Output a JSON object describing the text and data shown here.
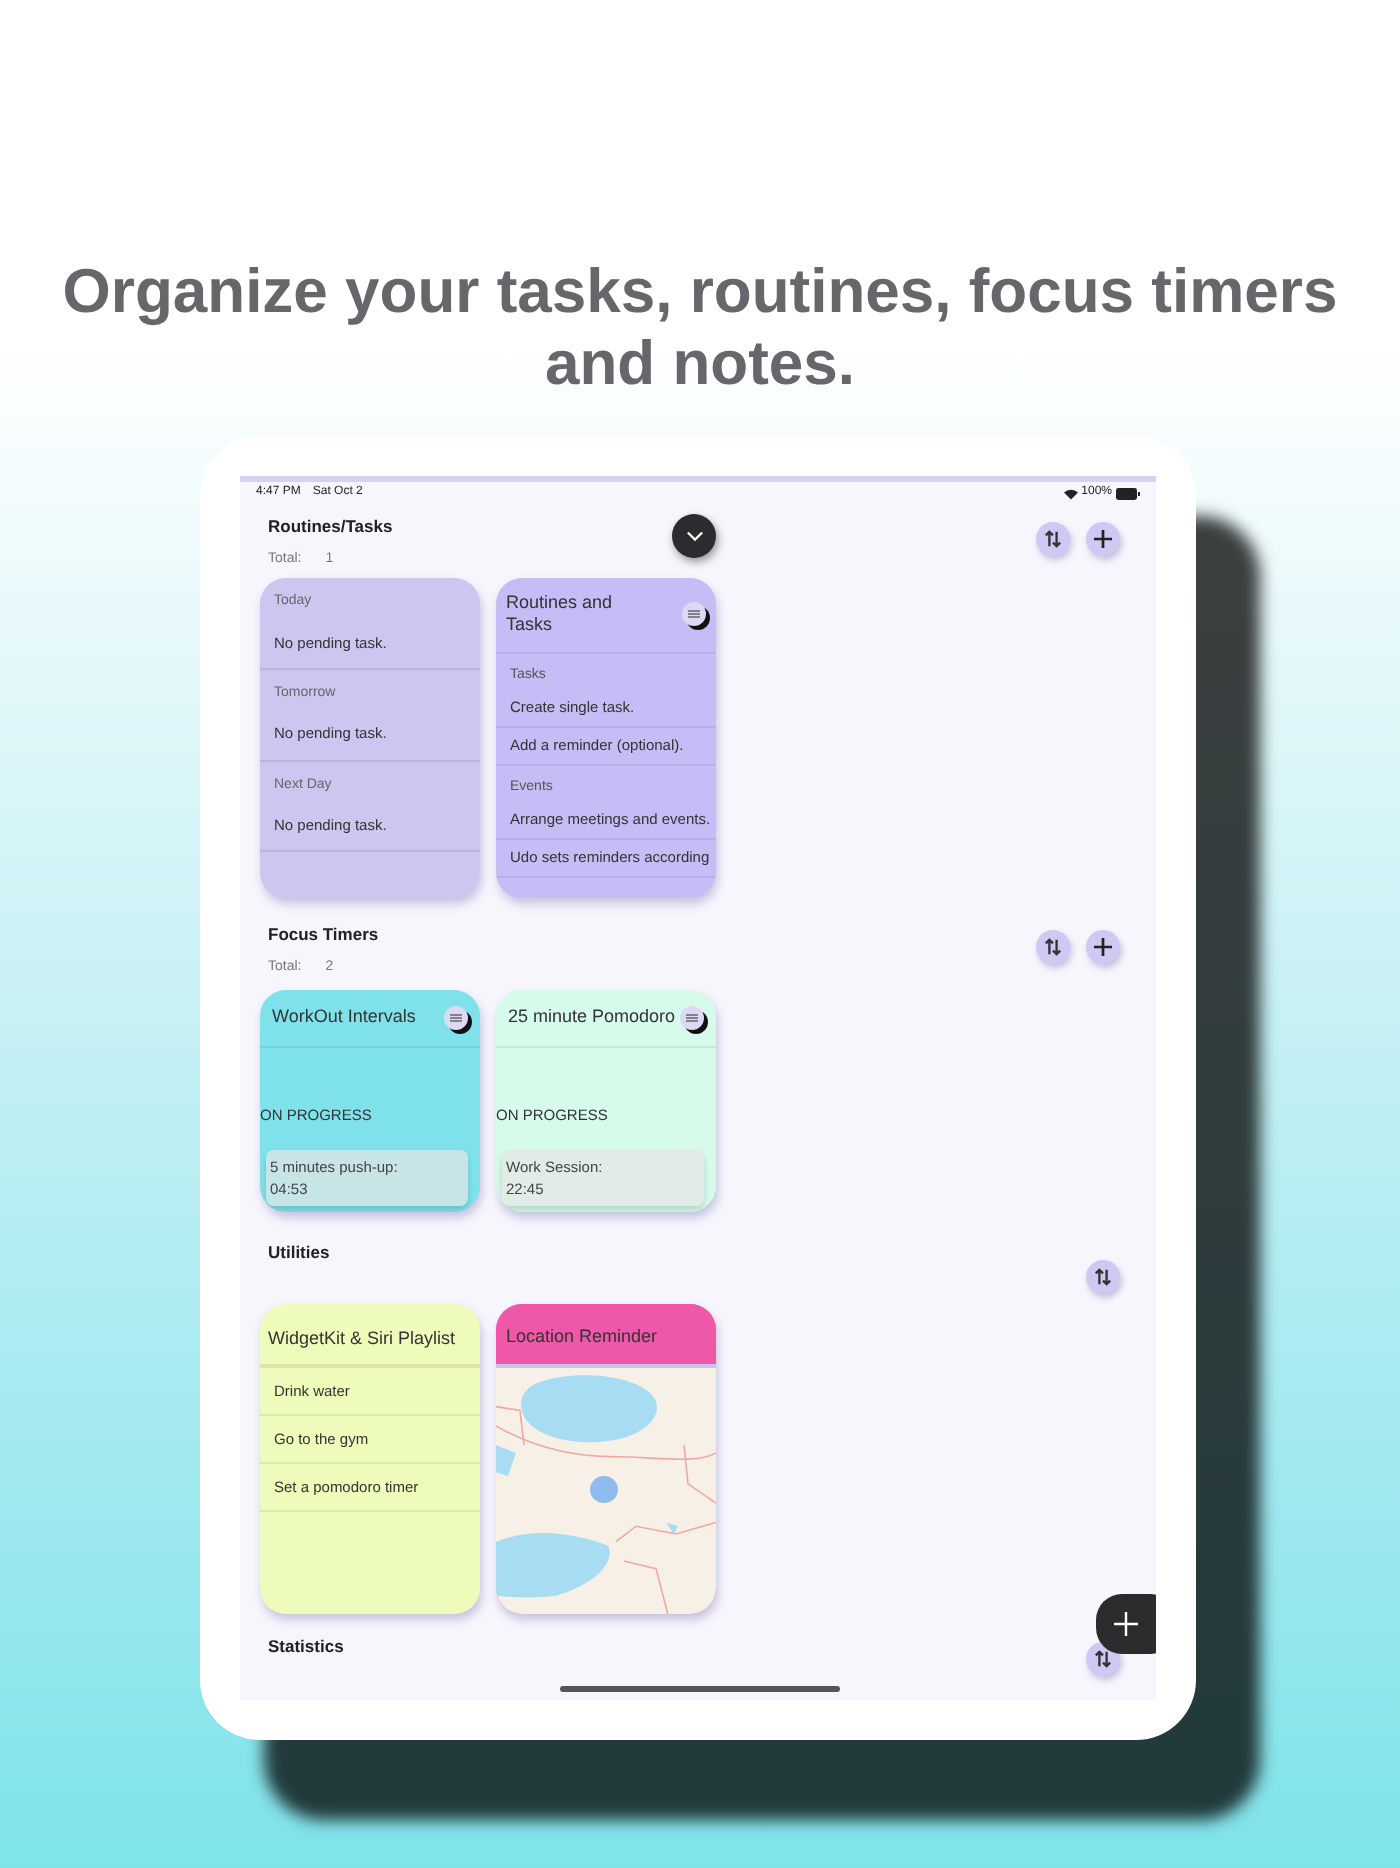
{
  "headline": "Organize your tasks, routines, focus timers and notes.",
  "status_bar": {
    "time": "4:47 PM",
    "date": "Sat Oct 2",
    "battery": "100%"
  },
  "sections": [
    {
      "title": "Routines/Tasks",
      "total_label": "Total:",
      "total": "1",
      "buttons": [
        {
          "kind": "sort"
        },
        {
          "kind": "add"
        }
      ],
      "collapse_button": true,
      "cards": [
        {
          "kind": "days",
          "color": "#cdc6f1",
          "days": [
            {
              "label": "Today",
              "text": "No pending task."
            },
            {
              "label": "Tomorrow",
              "text": "No pending task."
            },
            {
              "label": "Next Day",
              "text": "No pending task."
            }
          ]
        },
        {
          "kind": "note",
          "color": "#c6bdf6",
          "title": "Routines and Tasks",
          "groups": [
            {
              "heading": "Tasks",
              "items": [
                "Create single task.",
                "Add a reminder (optional)."
              ]
            },
            {
              "heading": "Events",
              "items": [
                "Arrange meetings and events.",
                "Udo sets reminders according"
              ]
            }
          ]
        }
      ]
    },
    {
      "title": "Focus Timers",
      "total_label": "Total:",
      "total": "2",
      "buttons": [
        {
          "kind": "sort"
        },
        {
          "kind": "add"
        }
      ],
      "cards": [
        {
          "kind": "timer",
          "color": "#7fe2ea",
          "title": "WorkOut Intervals",
          "status": "ON PROGRESS",
          "step": "5 minutes push-up:",
          "time": "04:53"
        },
        {
          "kind": "timer",
          "color": "#d6fbea",
          "title": "25 minute Pomodoro",
          "status": "ON PROGRESS",
          "step": "Work Session:",
          "time": "22:45"
        }
      ]
    },
    {
      "title": "Utilities",
      "buttons": [
        {
          "kind": "sort"
        }
      ],
      "cards": [
        {
          "kind": "checklist",
          "color": "#eefcbb",
          "title": "WidgetKit & Siri Playlist",
          "items": [
            "Drink water",
            "Go to the gym",
            "Set a pomodoro timer"
          ]
        },
        {
          "kind": "map",
          "color": "#ef58a8",
          "title": "Location Reminder"
        }
      ]
    },
    {
      "title": "Statistics",
      "buttons": [
        {
          "kind": "sort"
        }
      ]
    }
  ]
}
